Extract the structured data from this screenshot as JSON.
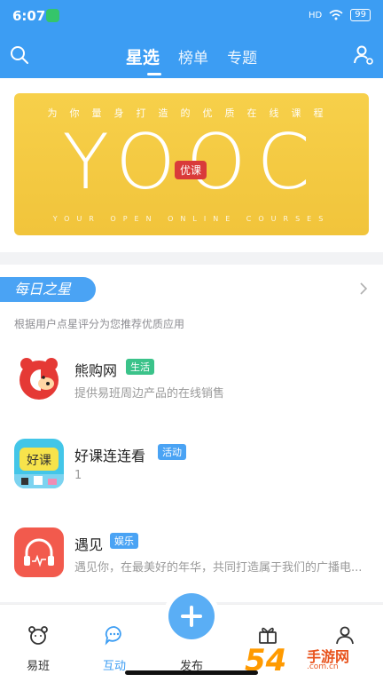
{
  "status": {
    "time": "6:07",
    "network": "HD",
    "battery": "99"
  },
  "header": {
    "tabs": [
      {
        "label": "星选",
        "active": true
      },
      {
        "label": "榜单",
        "active": false
      },
      {
        "label": "专题",
        "active": false
      }
    ]
  },
  "banner": {
    "tagline": "为你量身打造的优质在线课程",
    "brand": "YOOC",
    "badge": "优课",
    "subtitle": "YOUR OPEN ONLINE COURSES"
  },
  "daily_star": {
    "title": "每日之星",
    "desc": "根据用户点星评分为您推荐优质应用",
    "apps": [
      {
        "name": "熊购网",
        "tag": "生活",
        "tag_color": "#3bc38a",
        "desc": "提供易班周边产品的在线销售"
      },
      {
        "name": "好课连连看",
        "tag": "活动",
        "tag_color": "#4aa3f4",
        "desc": "1"
      },
      {
        "name": "遇见",
        "tag": "娱乐",
        "tag_color": "#4aa3f4",
        "desc": "遇见你，在最美好的年华，共同打造属于我们的广播电..."
      }
    ]
  },
  "bottom_nav": [
    {
      "label": "易班",
      "active": false,
      "icon": "bear-icon"
    },
    {
      "label": "互动",
      "active": true,
      "icon": "chat-icon"
    },
    {
      "label": "发布",
      "active": false,
      "icon": "plus-icon"
    },
    {
      "label": "",
      "active": false,
      "icon": "gift-icon"
    },
    {
      "label": "",
      "active": false,
      "icon": "person-icon"
    }
  ],
  "watermark": {
    "number": "54",
    "text": "手游网",
    "url": ".com.cn"
  },
  "colors": {
    "primary": "#3c9df3",
    "banner": "#f3c83f",
    "accent_red": "#d93a3a"
  }
}
